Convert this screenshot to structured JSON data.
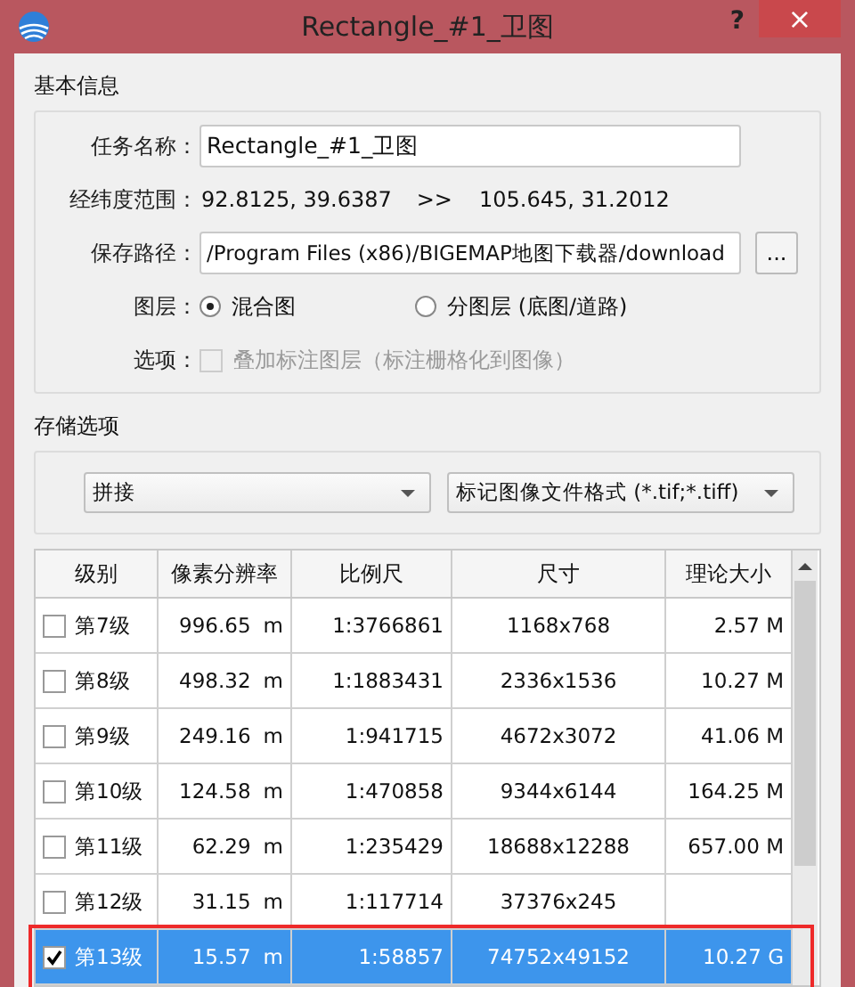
{
  "window": {
    "title": "Rectangle_#1_卫图",
    "help": "?",
    "close": "×"
  },
  "basic_info": {
    "title": "基本信息",
    "task_name": {
      "label": "任务名称：",
      "value": "Rectangle_#1_卫图"
    },
    "range": {
      "label": "经纬度范围：",
      "start": "92.8125, 39.6387",
      "separator": ">>",
      "end": "105.645, 31.2012"
    },
    "save_path": {
      "label": "保存路径：",
      "value": "/Program Files (x86)/BIGEMAP地图下载器/download",
      "browse": "..."
    },
    "layer": {
      "label": "图层：",
      "options": [
        {
          "label": "混合图",
          "selected": true
        },
        {
          "label": "分图层 (底图/道路)",
          "selected": false
        }
      ]
    },
    "options": {
      "label": "选项：",
      "checkbox": {
        "label": "叠加标注图层（标注栅格化到图像）",
        "checked": false,
        "disabled": true
      }
    }
  },
  "storage": {
    "title": "存储选项",
    "dropdowns": [
      {
        "value": "拼接"
      },
      {
        "value": "标记图像文件格式 (*.tif;*.tiff)"
      }
    ]
  },
  "table": {
    "columns": [
      "级别",
      "像素分辨率",
      "比例尺",
      "尺寸",
      "理论大小"
    ],
    "rows": [
      {
        "checked": false,
        "selected": false,
        "highlighted": false,
        "level": "第7级",
        "resolution": "996.65",
        "unit": "m",
        "scale": "1:3766861",
        "size": "1168x768",
        "estimate": "2.57 M"
      },
      {
        "checked": false,
        "selected": false,
        "highlighted": false,
        "level": "第8级",
        "resolution": "498.32",
        "unit": "m",
        "scale": "1:1883431",
        "size": "2336x1536",
        "estimate": "10.27 M"
      },
      {
        "checked": false,
        "selected": false,
        "highlighted": false,
        "level": "第9级",
        "resolution": "249.16",
        "unit": "m",
        "scale": "1:941715",
        "size": "4672x3072",
        "estimate": "41.06 M"
      },
      {
        "checked": false,
        "selected": false,
        "highlighted": false,
        "level": "第10级",
        "resolution": "124.58",
        "unit": "m",
        "scale": "1:470858",
        "size": "9344x6144",
        "estimate": "164.25 M"
      },
      {
        "checked": false,
        "selected": false,
        "highlighted": false,
        "level": "第11级",
        "resolution": "62.29",
        "unit": "m",
        "scale": "1:235429",
        "size": "18688x12288",
        "estimate": "657.00 M"
      },
      {
        "checked": false,
        "selected": false,
        "highlighted": false,
        "level": "第12级",
        "resolution": "31.15",
        "unit": "m",
        "scale": "1:117714",
        "size": "37376x245"
      },
      {
        "checked": true,
        "selected": true,
        "highlighted": true,
        "level": "第13级",
        "resolution": "15.57",
        "unit": "m",
        "scale": "1:58857",
        "size": "74752x49152",
        "estimate": "10.27 G"
      }
    ]
  }
}
